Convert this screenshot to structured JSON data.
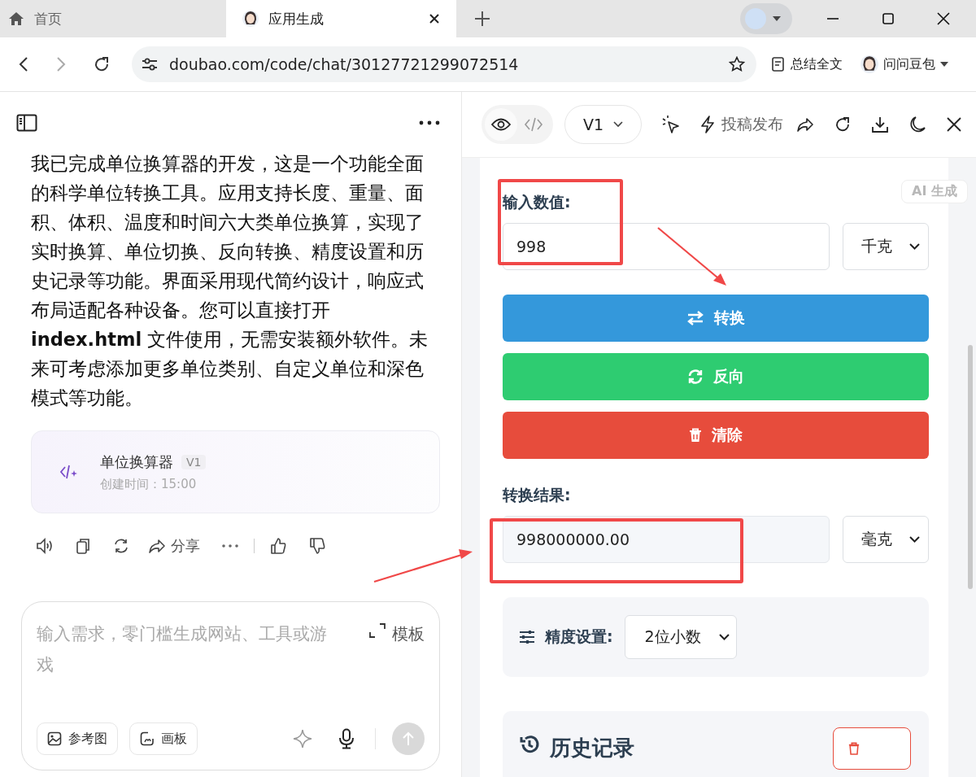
{
  "browser": {
    "tabs": [
      {
        "label": "首页",
        "kind": "home",
        "selected": false
      },
      {
        "label": "应用生成",
        "kind": "avatar",
        "selected": true
      }
    ],
    "url": "doubao.com/code/chat/30127721299072514",
    "summarize": "总结全文",
    "profile": "问问豆包"
  },
  "chat": {
    "message": "我已完成单位换算器的开发，这是一个功能全面的科学单位转换工具。应用支持长度、重量、面积、体积、温度和时间六大类单位换算，实现了实时换算、单位切换、反向转换、精度设置和历史记录等功能。界面采用现代简约设计，响应式布局适配各种设备。您可以直接打开 **index.html** 文件使用，无需安装额外软件。未来可考虑添加更多单位类别、自定义单位和深色模式等功能。",
    "artifact": {
      "title": "单位换算器",
      "version": "V1",
      "time": "创建时间：15:00"
    },
    "share": "分享",
    "composer": {
      "placeholder": "输入需求，零门槛生成网站、工具或游戏",
      "template": "模板",
      "chips": [
        "参考图",
        "画板"
      ]
    }
  },
  "preview": {
    "toolbar": {
      "views": [
        {
          "kind": "eye",
          "selected": true
        },
        {
          "kind": "code",
          "selected": false
        }
      ],
      "version": "V1",
      "publish": "投稿发布"
    },
    "badge": "AI 生成",
    "input_label": "输入数值:",
    "input_value": "998",
    "from_unit": "千克",
    "buttons": [
      {
        "label": "转换",
        "kind": "convert",
        "color": "#3498db"
      },
      {
        "label": "反向",
        "kind": "reverse",
        "color": "#2ecc71"
      },
      {
        "label": "清除",
        "kind": "clear",
        "color": "#e74c3c"
      }
    ],
    "result_label": "转换结果:",
    "result_value": "998000000.00",
    "to_unit": "毫克",
    "precision_label": "精度设置:",
    "precision": "2位小数",
    "history_title": "历史记录"
  }
}
